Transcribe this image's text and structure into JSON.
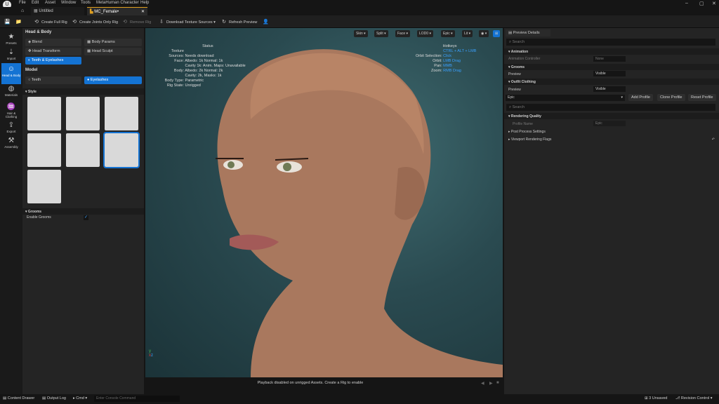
{
  "menu": [
    "File",
    "Edit",
    "Asset",
    "Window",
    "Tools",
    "MetaHuman Character",
    "Help"
  ],
  "tabs": {
    "untitled": "Untitled",
    "active": "MC_Female•"
  },
  "toolbar": {
    "create_full_rig": "Create Full Rig",
    "create_joints_rig": "Create Joints Only Rig",
    "remove_rig": "Remove Rig",
    "download_textures": "Download Texture Sources ▾",
    "refresh_preview": "Refresh Preview"
  },
  "rail": [
    "Presets",
    "Import",
    "Head & Body",
    "Materials",
    "Hair & Clothing",
    "Export",
    "Assembly"
  ],
  "left": {
    "header": "Head & Body",
    "blend": "Blend",
    "body_params": "Body Params",
    "head_transform": "Head Transform",
    "head_sculpt": "Head Sculpt",
    "teeth_eyelashes": "Teeth & Eyelashes",
    "model_label": "Model",
    "teeth": "Teeth",
    "eyelashes": "Eyelashes",
    "style_label": "Style",
    "grooms_label": "Grooms",
    "enable_grooms": "Enable Grooms"
  },
  "viewport": {
    "buttons": [
      "Skin ▾",
      "Split ▾",
      "Face ▾",
      "LOD0 ▾",
      "Epic ▾",
      "Lit ▾",
      "◉ ▾",
      "⊞"
    ],
    "status_title": "Status",
    "status": [
      [
        "Texture Sources:",
        "Needs download"
      ],
      [
        "Face:",
        "Albedo: 1k Normal: 1k"
      ],
      [
        "",
        "Cavity 1k: Anim. Maps: Unavailable"
      ],
      [
        "Body:",
        "Albedo: 2k Normal: 2k"
      ],
      [
        "",
        "Cavity: 2k, Masks: 1k"
      ],
      [
        "Body Type:",
        "Parametric"
      ],
      [
        "Rig State:",
        "Unrigged"
      ]
    ],
    "hotkeys_title": "Hotkeys",
    "hotkeys": [
      [
        "Orbit Selection:",
        "CTRL + ALT + LMB Click"
      ],
      [
        "Orbit:",
        "LMB Drag"
      ],
      [
        "Pan:",
        "MMB"
      ],
      [
        "Zoom:",
        "RMB Drag"
      ]
    ],
    "footer": "Playback disabled on unrigged Assets. Create a Rig to enable"
  },
  "right": {
    "tabs": "Preview Details",
    "search_placeholder": "Search",
    "animation": "Animation",
    "anim_controller": "Animation Controller",
    "anim_value": "None",
    "grooms": "Grooms",
    "groom_preview": "Preview",
    "groom_value": "Visible",
    "outfit": "Outfit Clothing",
    "outfit_preview": "Preview",
    "outfit_value": "Visible",
    "profile": "Epic",
    "add_profile": "Add Profile",
    "clone_profile": "Clone Profile",
    "reset_profile": "Reset Profile",
    "search2_placeholder": "Search",
    "rendering_quality": "Rendering Quality",
    "profile_name": "Profile Name",
    "profile_name_value": "Epic",
    "post_process": "Post Process Settings",
    "viewport_flags": "Viewport Rendering Flags"
  },
  "bottom": {
    "content_drawer": "Content Drawer",
    "output_log": "Output Log",
    "cmd": "Cmd ▾",
    "console_placeholder": "Enter Console Command",
    "unsaved": "3 Unsaved",
    "revision": "Revision Control ▾"
  }
}
